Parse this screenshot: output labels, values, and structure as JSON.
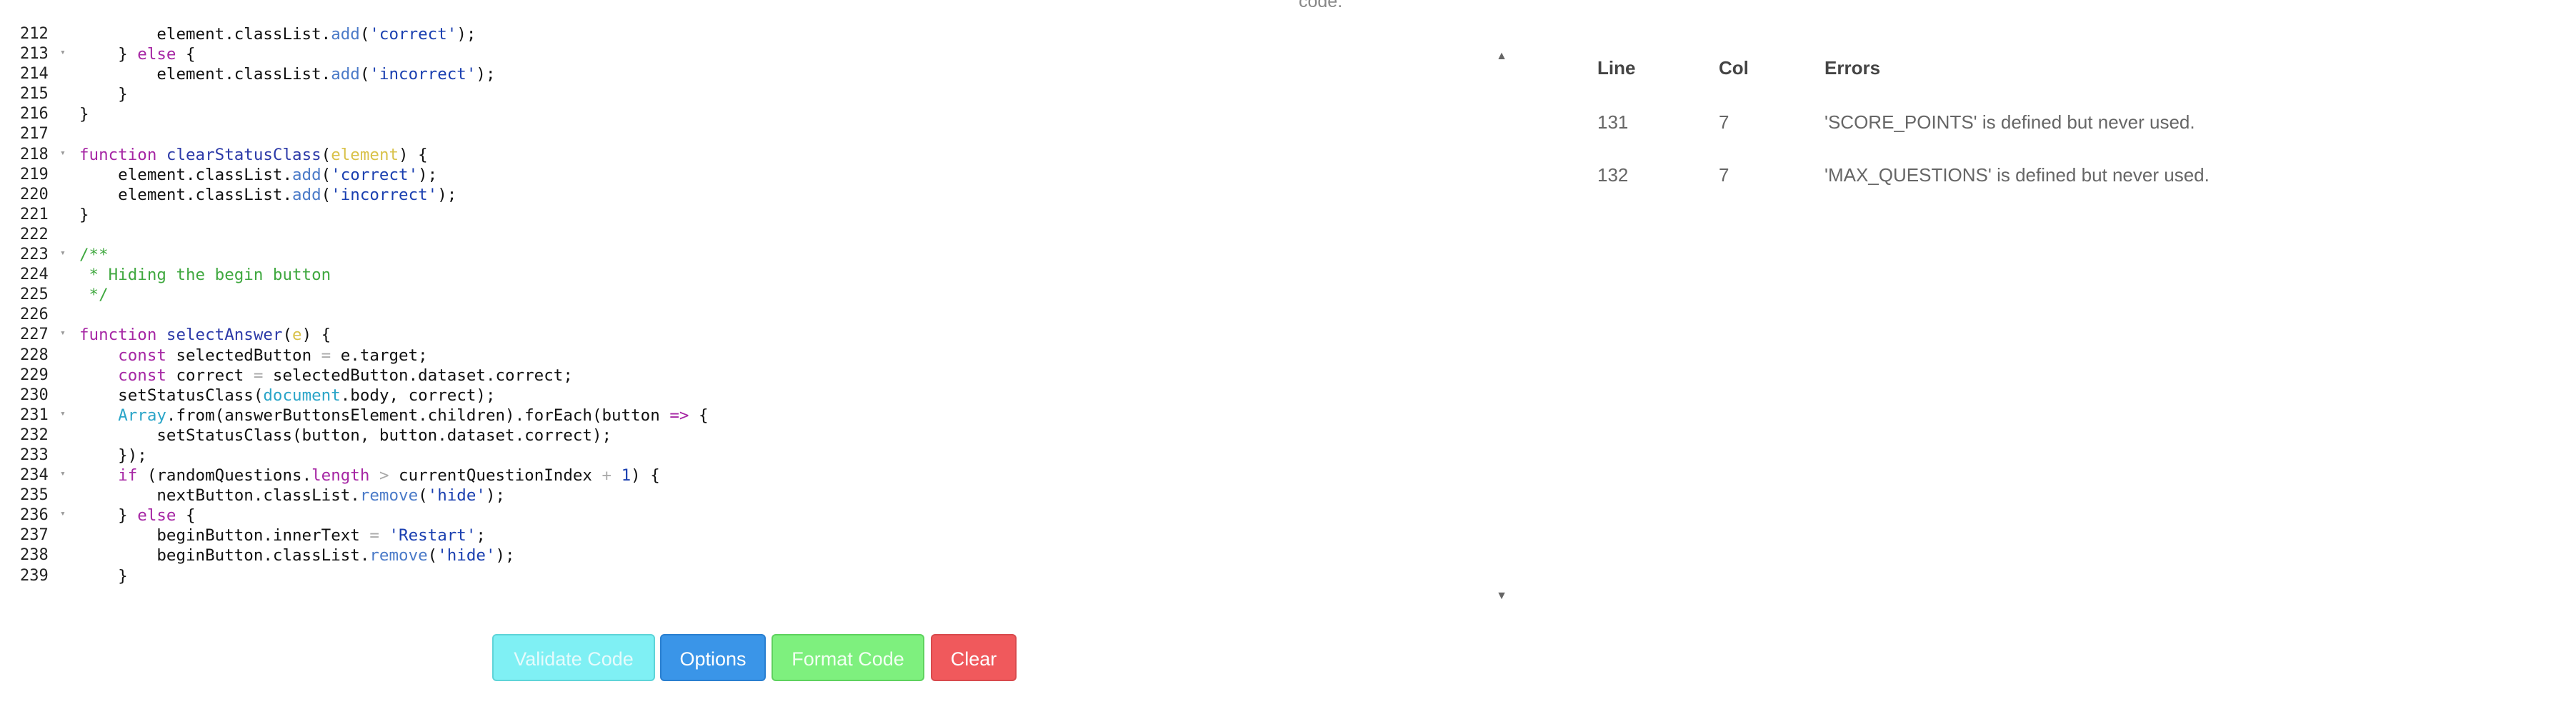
{
  "top_caption": "code.",
  "editor": {
    "lines": [
      {
        "num": "212",
        "fold": false,
        "tokens": [
          {
            "t": "        element.classList."
          },
          {
            "t": "add",
            "c": "method"
          },
          {
            "t": "("
          },
          {
            "t": "'correct'",
            "c": "str"
          },
          {
            "t": ");"
          }
        ]
      },
      {
        "num": "213",
        "fold": true,
        "tokens": [
          {
            "t": "    } "
          },
          {
            "t": "else",
            "c": "keyword"
          },
          {
            "t": " {"
          }
        ]
      },
      {
        "num": "214",
        "fold": false,
        "tokens": [
          {
            "t": "        element.classList."
          },
          {
            "t": "add",
            "c": "method"
          },
          {
            "t": "("
          },
          {
            "t": "'incorrect'",
            "c": "str"
          },
          {
            "t": ");"
          }
        ]
      },
      {
        "num": "215",
        "fold": false,
        "tokens": [
          {
            "t": "    }"
          }
        ]
      },
      {
        "num": "216",
        "fold": false,
        "tokens": [
          {
            "t": "}"
          }
        ]
      },
      {
        "num": "217",
        "fold": false,
        "tokens": [
          {
            "t": ""
          }
        ]
      },
      {
        "num": "218",
        "fold": true,
        "tokens": [
          {
            "t": "function",
            "c": "keyword"
          },
          {
            "t": " "
          },
          {
            "t": "clearStatusClass",
            "c": "fn"
          },
          {
            "t": "("
          },
          {
            "t": "element",
            "c": "param"
          },
          {
            "t": ") {"
          }
        ]
      },
      {
        "num": "219",
        "fold": false,
        "tokens": [
          {
            "t": "    element.classList."
          },
          {
            "t": "add",
            "c": "method"
          },
          {
            "t": "("
          },
          {
            "t": "'correct'",
            "c": "str"
          },
          {
            "t": ");"
          }
        ]
      },
      {
        "num": "220",
        "fold": false,
        "tokens": [
          {
            "t": "    element.classList."
          },
          {
            "t": "add",
            "c": "method"
          },
          {
            "t": "("
          },
          {
            "t": "'incorrect'",
            "c": "str"
          },
          {
            "t": ");"
          }
        ]
      },
      {
        "num": "221",
        "fold": false,
        "tokens": [
          {
            "t": "}"
          }
        ]
      },
      {
        "num": "222",
        "fold": false,
        "tokens": [
          {
            "t": ""
          }
        ]
      },
      {
        "num": "223",
        "fold": true,
        "tokens": [
          {
            "t": "/**",
            "c": "comment"
          }
        ]
      },
      {
        "num": "224",
        "fold": false,
        "tokens": [
          {
            "t": " * Hiding the begin button",
            "c": "comment"
          }
        ]
      },
      {
        "num": "225",
        "fold": false,
        "tokens": [
          {
            "t": " */",
            "c": "comment"
          }
        ]
      },
      {
        "num": "226",
        "fold": false,
        "tokens": [
          {
            "t": ""
          }
        ]
      },
      {
        "num": "227",
        "fold": true,
        "tokens": [
          {
            "t": "function",
            "c": "keyword"
          },
          {
            "t": " "
          },
          {
            "t": "selectAnswer",
            "c": "fn"
          },
          {
            "t": "("
          },
          {
            "t": "e",
            "c": "param"
          },
          {
            "t": ") {"
          }
        ]
      },
      {
        "num": "228",
        "fold": false,
        "tokens": [
          {
            "t": "    "
          },
          {
            "t": "const",
            "c": "keyword"
          },
          {
            "t": " selectedButton "
          },
          {
            "t": "=",
            "c": "op"
          },
          {
            "t": " e.target;"
          }
        ]
      },
      {
        "num": "229",
        "fold": false,
        "tokens": [
          {
            "t": "    "
          },
          {
            "t": "const",
            "c": "keyword"
          },
          {
            "t": " correct "
          },
          {
            "t": "=",
            "c": "op"
          },
          {
            "t": " selectedButton.dataset.correct;"
          }
        ]
      },
      {
        "num": "230",
        "fold": false,
        "tokens": [
          {
            "t": "    setStatusClass("
          },
          {
            "t": "document",
            "c": "builtin"
          },
          {
            "t": ".body, correct);"
          }
        ]
      },
      {
        "num": "231",
        "fold": true,
        "tokens": [
          {
            "t": "    "
          },
          {
            "t": "Array",
            "c": "builtin"
          },
          {
            "t": ".from(answerButtonsElement.children).forEach(button "
          },
          {
            "t": "=>",
            "c": "keyword"
          },
          {
            "t": " {"
          }
        ]
      },
      {
        "num": "232",
        "fold": false,
        "tokens": [
          {
            "t": "        setStatusClass(button, button.dataset.correct);"
          }
        ]
      },
      {
        "num": "233",
        "fold": false,
        "tokens": [
          {
            "t": "    });"
          }
        ]
      },
      {
        "num": "234",
        "fold": true,
        "tokens": [
          {
            "t": "    "
          },
          {
            "t": "if",
            "c": "keyword"
          },
          {
            "t": " (randomQuestions."
          },
          {
            "t": "length",
            "c": "keyword"
          },
          {
            "t": " "
          },
          {
            "t": ">",
            "c": "op"
          },
          {
            "t": " currentQuestionIndex "
          },
          {
            "t": "+",
            "c": "op"
          },
          {
            "t": " "
          },
          {
            "t": "1",
            "c": "num"
          },
          {
            "t": ") {"
          }
        ]
      },
      {
        "num": "235",
        "fold": false,
        "tokens": [
          {
            "t": "        nextButton.classList."
          },
          {
            "t": "remove",
            "c": "method"
          },
          {
            "t": "("
          },
          {
            "t": "'hide'",
            "c": "str"
          },
          {
            "t": ");"
          }
        ]
      },
      {
        "num": "236",
        "fold": true,
        "tokens": [
          {
            "t": "    } "
          },
          {
            "t": "else",
            "c": "keyword"
          },
          {
            "t": " {"
          }
        ]
      },
      {
        "num": "237",
        "fold": false,
        "tokens": [
          {
            "t": "        beginButton.innerText "
          },
          {
            "t": "=",
            "c": "op"
          },
          {
            "t": " "
          },
          {
            "t": "'Restart'",
            "c": "str"
          },
          {
            "t": ";"
          }
        ]
      },
      {
        "num": "238",
        "fold": false,
        "tokens": [
          {
            "t": "        beginButton.classList."
          },
          {
            "t": "remove",
            "c": "method"
          },
          {
            "t": "("
          },
          {
            "t": "'hide'",
            "c": "str"
          },
          {
            "t": ");"
          }
        ]
      },
      {
        "num": "239",
        "fold": false,
        "tokens": [
          {
            "t": "    }"
          }
        ]
      }
    ]
  },
  "errors": {
    "headers": {
      "line": "Line",
      "col": "Col",
      "errors": "Errors"
    },
    "rows": [
      {
        "line": "131",
        "col": "7",
        "message": "'SCORE_POINTS' is defined but never used."
      },
      {
        "line": "132",
        "col": "7",
        "message": "'MAX_QUESTIONS' is defined but never used."
      }
    ]
  },
  "buttons": {
    "validate": "Validate Code",
    "options": "Options",
    "format": "Format Code",
    "clear": "Clear"
  },
  "icons": {
    "scroll_up": "chevron-up-icon",
    "scroll_down": "chevron-down-icon",
    "fold": "fold-arrow-icon"
  }
}
